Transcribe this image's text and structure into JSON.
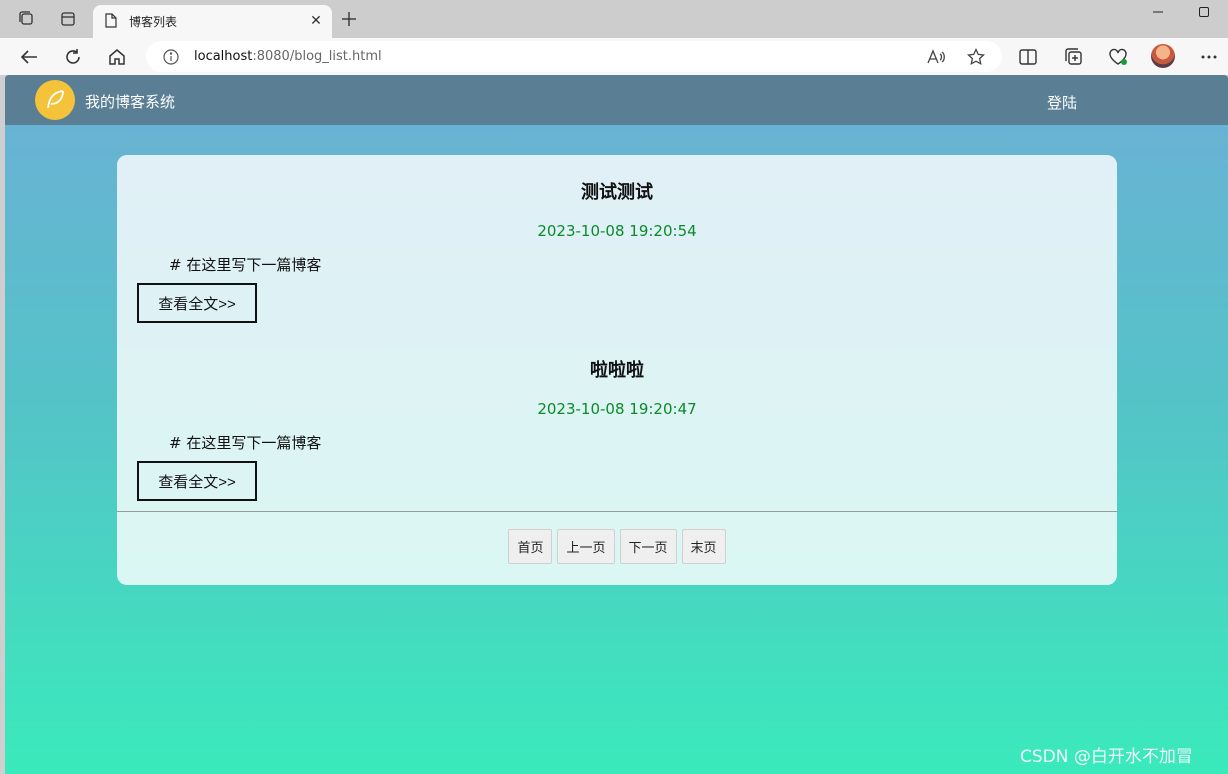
{
  "browser": {
    "tab_title": "博客列表",
    "url_host": "localhost",
    "url_rest": ":8080/blog_list.html"
  },
  "page": {
    "brand": "我的博客系统",
    "login_label": "登陆",
    "blogs": [
      {
        "title": "测试测试",
        "date": "2023-10-08 19:20:54",
        "desc": "# 在这里写下一篇博客",
        "link_label": "查看全文>>"
      },
      {
        "title": "啦啦啦",
        "date": "2023-10-08 19:20:47",
        "desc": "# 在这里写下一篇博客",
        "link_label": "查看全文>>"
      }
    ],
    "pagination": {
      "first": "首页",
      "prev": "上一页",
      "next": "下一页",
      "last": "末页"
    }
  },
  "watermark": "CSDN @白开水不加冒",
  "colors": {
    "nav": "#5a7f94",
    "date": "#0a8a2a",
    "logo": "#f5c33a"
  },
  "icons": [
    "workspaces-icon",
    "tab-actions-icon",
    "page-icon",
    "close-icon",
    "plus-icon",
    "minimize-icon",
    "maximize-icon",
    "back-icon",
    "refresh-icon",
    "home-icon",
    "info-icon",
    "read-aloud-icon",
    "favorite-star-icon",
    "split-screen-icon",
    "collections-icon",
    "browser-essentials-icon",
    "profile-avatar",
    "more-icon",
    "feather-logo-icon"
  ]
}
